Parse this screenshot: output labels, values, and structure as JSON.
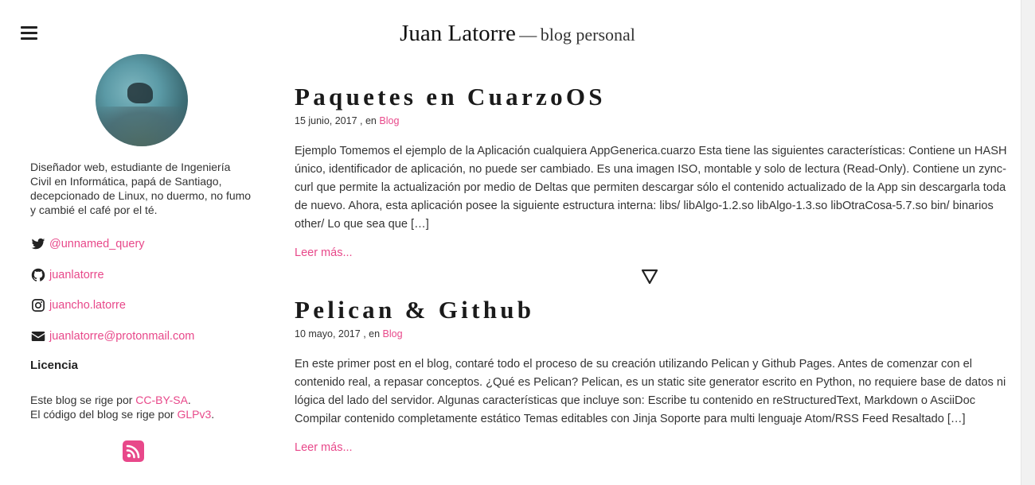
{
  "header": {
    "name": "Juan Latorre",
    "dash": "—",
    "subtitle": "blog personal"
  },
  "sidebar": {
    "bio": "Diseñador web, estudiante de Ingeniería Civil en Informática, papá de Santiago, decepcionado de Linux, no duermo, no fumo y cambié el café por el té.",
    "social": [
      {
        "icon": "twitter-icon",
        "label": "@unnamed_query"
      },
      {
        "icon": "github-icon",
        "label": "juanlatorre"
      },
      {
        "icon": "instagram-icon",
        "label": "juancho.latorre"
      },
      {
        "icon": "envelope-icon",
        "label": "juanlatorre@protonmail.com"
      }
    ],
    "licence": {
      "title": "Licencia",
      "line1_prefix": "Este blog se rige por ",
      "line1_link": "CC-BY-SA",
      "line1_suffix": ".",
      "line2_prefix": "El código del blog se rige por ",
      "line2_link": "GLPv3",
      "line2_suffix": "."
    }
  },
  "posts": [
    {
      "title": "Paquetes en CuarzoOS",
      "date": "15 junio, 2017",
      "in_text": ", en",
      "category": "Blog",
      "excerpt": "Ejemplo Tomemos el ejemplo de la Aplicación cualquiera AppGenerica.cuarzo Esta tiene las siguientes características: Contiene un HASH único, identificador de aplicación, no puede ser cambiado. Es una imagen ISO, montable y solo de lectura (Read-Only). Contiene un zync-curl que permite la actualización por medio de Deltas que permiten descargar sólo el contenido actualizado de la App sin descargarla toda de nuevo. Ahora, esta aplicación posee la siguiente estructura interna: libs/ libAlgo-1.2.so libAlgo-1.3.so libOtraCosa-5.7.so bin/ binarios other/ Lo que sea que […]",
      "read_more": "Leer más..."
    },
    {
      "title": "Pelican & Github",
      "date": "10 mayo, 2017",
      "in_text": ", en",
      "category": "Blog",
      "excerpt": "En este primer post en el blog, contaré todo el proceso de su creación utilizando Pelican y Github Pages. Antes de comenzar con el contenido real, a repasar conceptos. ¿Qué es Pelican? Pelican, es un static site generator escrito en Python, no requiere base de datos ni lógica del lado del servidor. Algunas características que incluye son: Escribe tu contenido en reStructuredText, Markdown o AsciiDoc Compilar contenido completamente estático Temas editables con Jinja Soporte para multi lenguaje Atom/RSS Feed Resaltado […]",
      "read_more": "Leer más..."
    }
  ],
  "colors": {
    "accent": "#e8488a",
    "text": "#333333",
    "title": "#1a1a1a"
  }
}
